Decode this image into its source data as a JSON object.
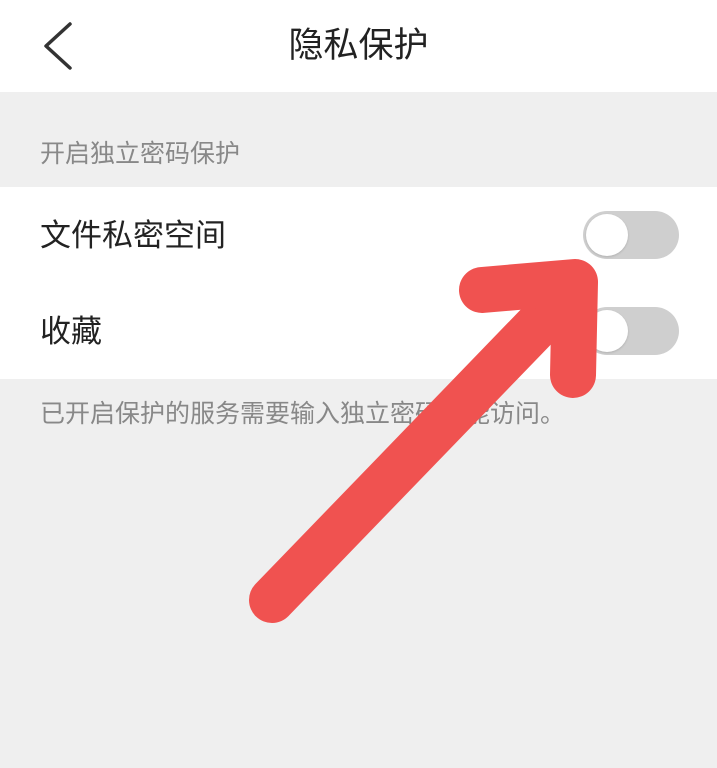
{
  "header": {
    "title": "隐私保护",
    "back_icon": "chevron-left-icon"
  },
  "section": {
    "header": "开启独立密码保护"
  },
  "settings": [
    {
      "label": "文件私密空间",
      "enabled": false
    },
    {
      "label": "收藏",
      "enabled": false
    }
  ],
  "footer_note": "已开启保护的服务需要输入独立密码才能访问。",
  "colors": {
    "background": "#efefef",
    "card": "#ffffff",
    "toggle_off": "#cfcfcf",
    "annotation_arrow": "#f05250"
  }
}
